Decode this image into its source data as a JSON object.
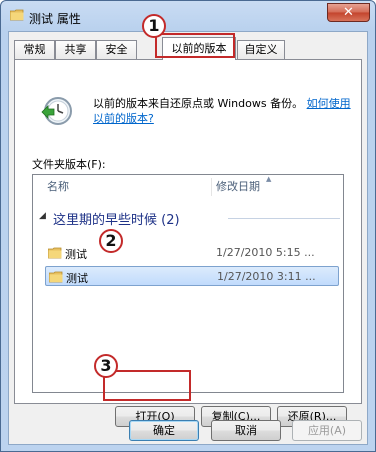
{
  "window": {
    "title": "测试 属性",
    "close_label": "✕"
  },
  "tabs": [
    {
      "label": "常规"
    },
    {
      "label": "共享"
    },
    {
      "label": "安全"
    },
    {
      "label": "以前的版本"
    },
    {
      "label": "自定义"
    }
  ],
  "info": {
    "text": "以前的版本来自还原点或 Windows 备份。",
    "link_text": "如何使用以前的版本?"
  },
  "versions": {
    "label": "文件夹版本(F):",
    "columns": {
      "name": "名称",
      "date": "修改日期"
    },
    "group": "这里期的早些时候 (2)",
    "items": [
      {
        "name": "测试",
        "date": "1/27/2010 5:15 ..."
      },
      {
        "name": "测试",
        "date": "1/27/2010 3:11 ..."
      }
    ]
  },
  "actions": {
    "open": "打开(O)",
    "copy": "复制(C)...",
    "restore": "还原(R)..."
  },
  "dialog": {
    "ok": "确定",
    "cancel": "取消",
    "apply": "应用(A)"
  },
  "callouts": {
    "one": "1",
    "two": "2",
    "three": "3"
  }
}
